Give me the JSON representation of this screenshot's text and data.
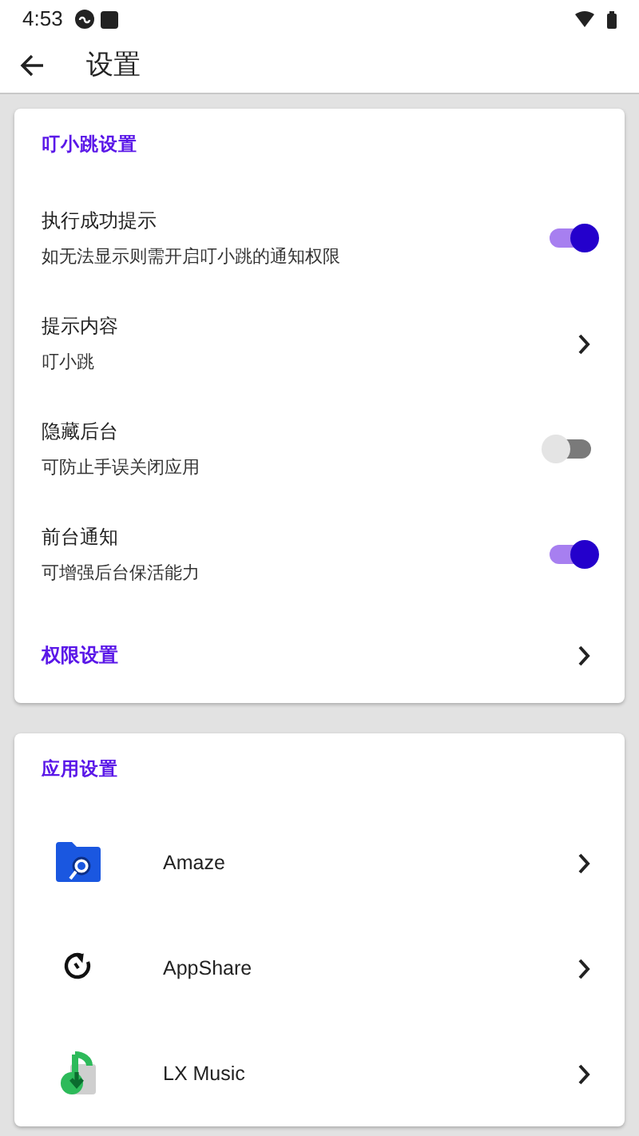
{
  "status_bar": {
    "time": "4:53"
  },
  "app_bar": {
    "title": "设置"
  },
  "sections": [
    {
      "title": "叮小跳设置",
      "items": [
        {
          "kind": "switch",
          "title": "执行成功提示",
          "subtitle": "如无法显示则需开启叮小跳的通知权限",
          "on": true
        },
        {
          "kind": "link",
          "title": "提示内容",
          "subtitle": "叮小跳"
        },
        {
          "kind": "switch",
          "title": "隐藏后台",
          "subtitle": "可防止手误关闭应用",
          "on": false
        },
        {
          "kind": "switch",
          "title": "前台通知",
          "subtitle": "可增强后台保活能力",
          "on": true
        },
        {
          "kind": "accent_link",
          "title": "权限设置"
        }
      ]
    },
    {
      "title": "应用设置",
      "items": [
        {
          "kind": "app",
          "title": "Amaze"
        },
        {
          "kind": "app",
          "title": "AppShare"
        },
        {
          "kind": "app",
          "title": "LX Music"
        }
      ]
    }
  ]
}
